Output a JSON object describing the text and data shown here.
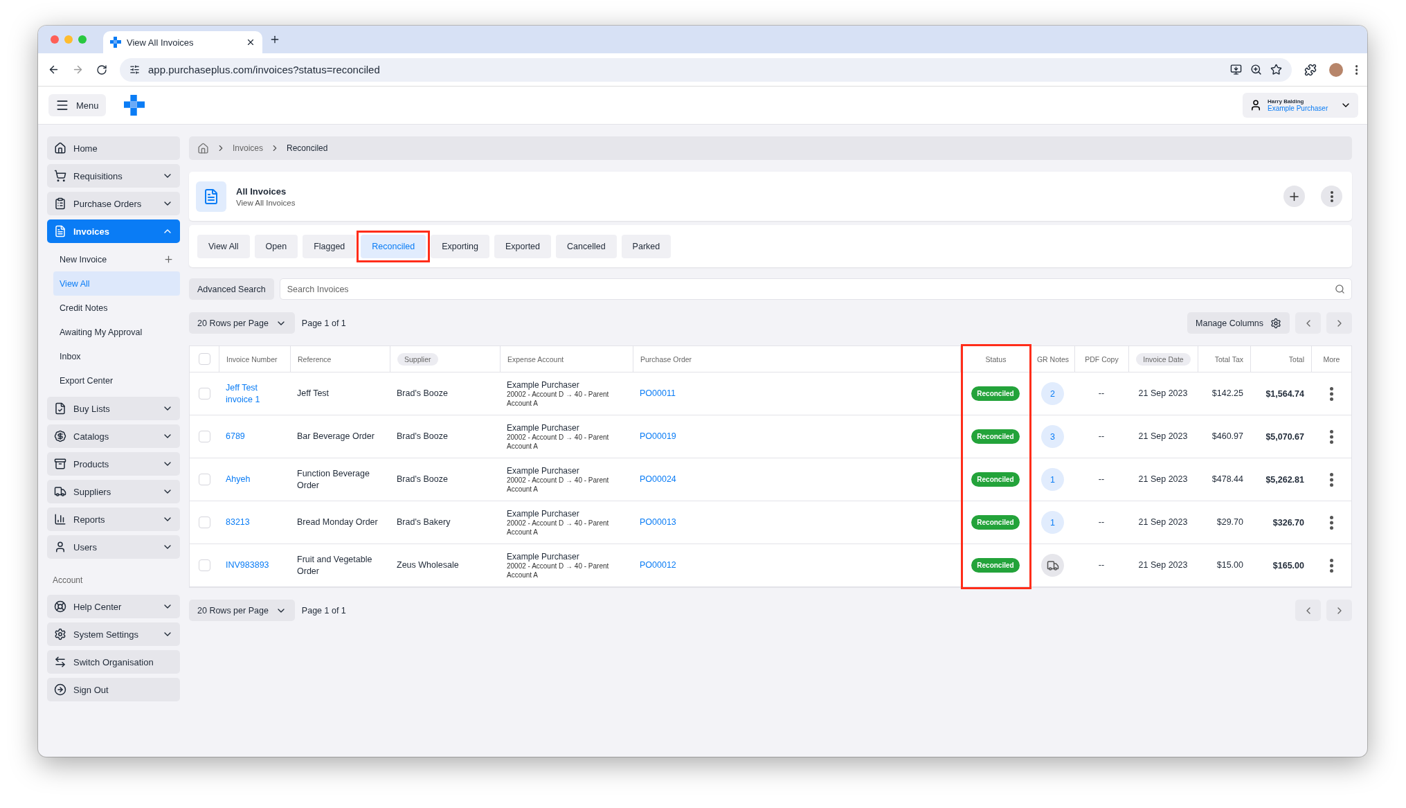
{
  "browser": {
    "tab_title": "View All Invoices",
    "url": "app.purchaseplus.com/invoices?status=reconciled"
  },
  "header": {
    "menu_label": "Menu",
    "user_name": "Harry Balding",
    "user_org": "Example Purchaser"
  },
  "sidebar": {
    "items": [
      {
        "label": "Home",
        "kind": "link",
        "selected": false
      },
      {
        "label": "Requisitions",
        "kind": "group",
        "selected": false,
        "expanded": false
      },
      {
        "label": "Purchase Orders",
        "kind": "group",
        "selected": false,
        "expanded": false
      },
      {
        "label": "Invoices",
        "kind": "group",
        "selected": true,
        "expanded": true,
        "children": [
          {
            "label": "New Invoice",
            "kind": "add",
            "selected": false
          },
          {
            "label": "View All",
            "kind": "link",
            "selected": true
          },
          {
            "label": "Credit Notes",
            "kind": "link",
            "selected": false
          },
          {
            "label": "Awaiting My Approval",
            "kind": "link",
            "selected": false
          },
          {
            "label": "Inbox",
            "kind": "link",
            "selected": false
          },
          {
            "label": "Export Center",
            "kind": "link",
            "selected": false
          }
        ]
      },
      {
        "label": "Buy Lists",
        "kind": "group",
        "selected": false,
        "expanded": false
      },
      {
        "label": "Catalogs",
        "kind": "group",
        "selected": false,
        "expanded": false
      },
      {
        "label": "Products",
        "kind": "group",
        "selected": false,
        "expanded": false
      },
      {
        "label": "Suppliers",
        "kind": "group",
        "selected": false,
        "expanded": false
      },
      {
        "label": "Reports",
        "kind": "group",
        "selected": false,
        "expanded": false
      },
      {
        "label": "Users",
        "kind": "group",
        "selected": false,
        "expanded": false
      }
    ],
    "account_label": "Account",
    "account_items": [
      {
        "label": "Help Center",
        "kind": "group",
        "selected": false,
        "expanded": false
      },
      {
        "label": "System Settings",
        "kind": "group",
        "selected": false,
        "expanded": false
      },
      {
        "label": "Switch Organisation",
        "kind": "link",
        "selected": false
      },
      {
        "label": "Sign Out",
        "kind": "link",
        "selected": false
      }
    ]
  },
  "breadcrumb": [
    "Invoices",
    "Reconciled"
  ],
  "page": {
    "title": "All Invoices",
    "subtitle": "View All Invoices"
  },
  "tabs": [
    {
      "label": "View All",
      "selected": false,
      "highlighted": false
    },
    {
      "label": "Open",
      "selected": false,
      "highlighted": false
    },
    {
      "label": "Flagged",
      "selected": false,
      "highlighted": false
    },
    {
      "label": "Reconciled",
      "selected": true,
      "highlighted": true
    },
    {
      "label": "Exporting",
      "selected": false,
      "highlighted": false
    },
    {
      "label": "Exported",
      "selected": false,
      "highlighted": false
    },
    {
      "label": "Cancelled",
      "selected": false,
      "highlighted": false
    },
    {
      "label": "Parked",
      "selected": false,
      "highlighted": false
    }
  ],
  "search": {
    "button": "Advanced Search",
    "placeholder": "Search Invoices"
  },
  "pagination": {
    "rows_per_page": "20 Rows per Page",
    "page": "Page 1 of 1",
    "manage_columns": "Manage Columns"
  },
  "table": {
    "select_all_checked": false,
    "columns": [
      {
        "label": "Invoice Number",
        "sorted": false,
        "highlighted": false
      },
      {
        "label": "Reference",
        "sorted": false,
        "highlighted": false
      },
      {
        "label": "Supplier",
        "sorted": true,
        "highlighted": false
      },
      {
        "label": "Expense Account",
        "sorted": false,
        "highlighted": false
      },
      {
        "label": "Purchase Order",
        "sorted": false,
        "highlighted": false
      },
      {
        "label": "Status",
        "sorted": false,
        "highlighted": true
      },
      {
        "label": "GR Notes",
        "sorted": false,
        "highlighted": false
      },
      {
        "label": "PDF Copy",
        "sorted": false,
        "highlighted": false
      },
      {
        "label": "Invoice Date",
        "sorted": true,
        "highlighted": false
      },
      {
        "label": "Total Tax",
        "sorted": false,
        "highlighted": false
      },
      {
        "label": "Total",
        "sorted": false,
        "highlighted": false
      },
      {
        "label": "More",
        "sorted": false,
        "highlighted": false
      }
    ],
    "rows": [
      {
        "checked": false,
        "invoice_number": "Jeff Test invoice 1",
        "reference": "Jeff Test",
        "supplier": "Brad's Booze",
        "expense_account": {
          "name": "Example Purchaser",
          "detail": "20002 - Account D → 40 - Parent Account A"
        },
        "purchase_order": "PO00011",
        "status": "Reconciled",
        "gr_notes": {
          "kind": "count",
          "value": "2"
        },
        "pdf_copy": "--",
        "invoice_date": "21 Sep 2023",
        "total_tax": "$142.25",
        "total": "$1,564.74"
      },
      {
        "checked": false,
        "invoice_number": "6789",
        "reference": "Bar Beverage Order",
        "supplier": "Brad's Booze",
        "expense_account": {
          "name": "Example Purchaser",
          "detail": "20002 - Account D → 40 - Parent Account A"
        },
        "purchase_order": "PO00019",
        "status": "Reconciled",
        "gr_notes": {
          "kind": "count",
          "value": "3"
        },
        "pdf_copy": "--",
        "invoice_date": "21 Sep 2023",
        "total_tax": "$460.97",
        "total": "$5,070.67"
      },
      {
        "checked": false,
        "invoice_number": "Ahyeh",
        "reference": "Function Beverage Order",
        "supplier": "Brad's Booze",
        "expense_account": {
          "name": "Example Purchaser",
          "detail": "20002 - Account D → 40 - Parent Account A"
        },
        "purchase_order": "PO00024",
        "status": "Reconciled",
        "gr_notes": {
          "kind": "count",
          "value": "1"
        },
        "pdf_copy": "--",
        "invoice_date": "21 Sep 2023",
        "total_tax": "$478.44",
        "total": "$5,262.81"
      },
      {
        "checked": false,
        "invoice_number": "83213",
        "reference": "Bread Monday Order",
        "supplier": "Brad's Bakery",
        "expense_account": {
          "name": "Example Purchaser",
          "detail": "20002 - Account D → 40 - Parent Account A"
        },
        "purchase_order": "PO00013",
        "status": "Reconciled",
        "gr_notes": {
          "kind": "count",
          "value": "1"
        },
        "pdf_copy": "--",
        "invoice_date": "21 Sep 2023",
        "total_tax": "$29.70",
        "total": "$326.70"
      },
      {
        "checked": false,
        "invoice_number": "INV983893",
        "reference": "Fruit and Vegetable Order",
        "supplier": "Zeus Wholesale",
        "expense_account": {
          "name": "Example Purchaser",
          "detail": "20002 - Account D → 40 - Parent Account A"
        },
        "purchase_order": "PO00012",
        "status": "Reconciled",
        "gr_notes": {
          "kind": "truck"
        },
        "pdf_copy": "--",
        "invoice_date": "21 Sep 2023",
        "total_tax": "$15.00",
        "total": "$165.00"
      }
    ]
  },
  "footer_pagination": {
    "rows_per_page": "20 Rows per Page",
    "page": "Page 1 of 1"
  }
}
